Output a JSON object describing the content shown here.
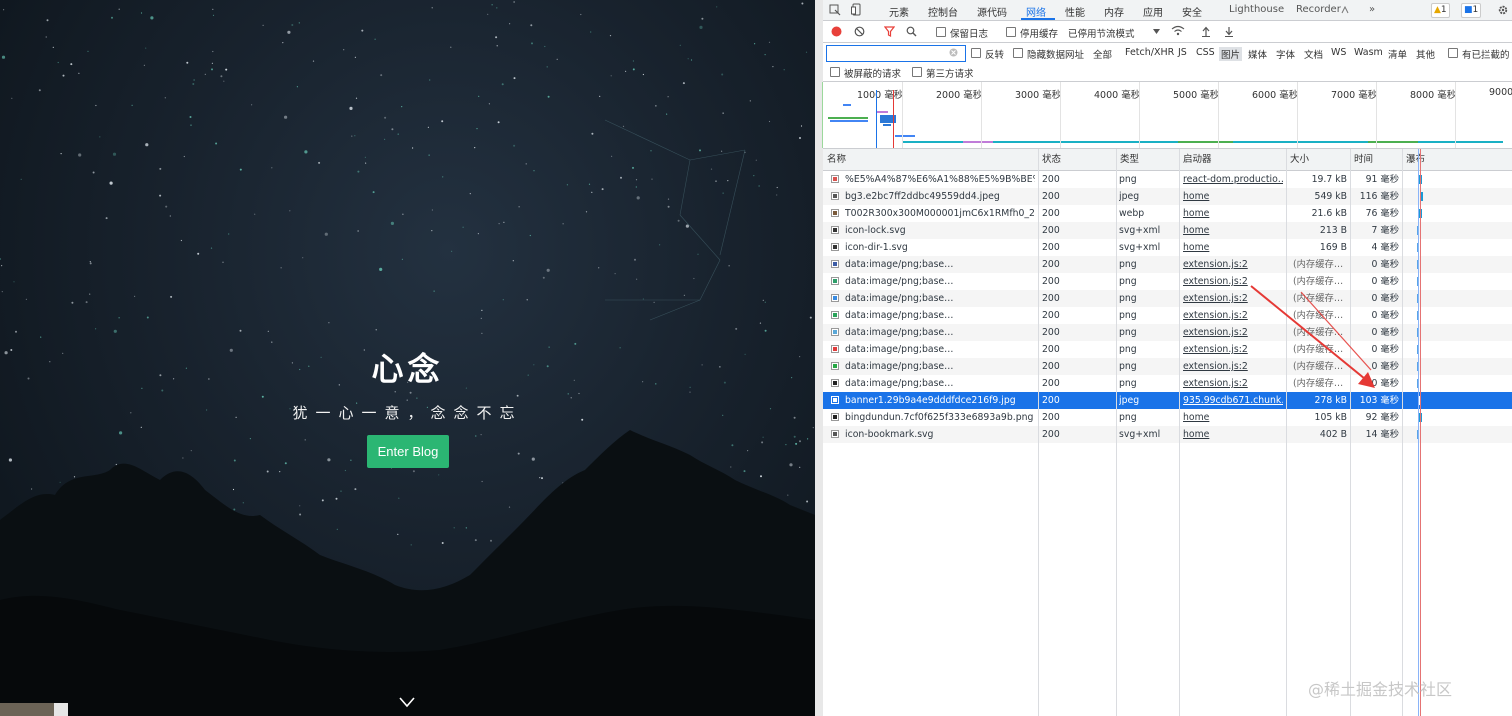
{
  "site": {
    "title": "心念",
    "subtitle": "犹一心一意，念念不忘",
    "enter_button": "Enter Blog"
  },
  "devtools": {
    "tabs": [
      "元素",
      "控制台",
      "源代码",
      "网络",
      "性能",
      "内存",
      "应用",
      "安全",
      "Lighthouse",
      "Recorder"
    ],
    "selected_tab": "网络",
    "more_tabs": "»",
    "warnings_badge": "1",
    "messages_badge": "1",
    "toolbar": {
      "preserve_log": "保留日志",
      "disable_cache": "停用缓存",
      "throttling": "已停用节流模式"
    },
    "filter": {
      "placeholder": "",
      "invert": "反转",
      "hide_data_urls": "隐藏数据网址",
      "types": [
        "全部",
        "Fetch/XHR",
        "JS",
        "CSS",
        "图片",
        "媒体",
        "字体",
        "文档",
        "WS",
        "Wasm",
        "清单",
        "其他"
      ],
      "selected_type": "图片",
      "blocked_cookies": "有已拦截的",
      "blocked_requests": "被屏蔽的请求",
      "third_party": "第三方请求"
    },
    "overview_ticks": [
      "1000 毫秒",
      "2000 毫秒",
      "3000 毫秒",
      "4000 毫秒",
      "5000 毫秒",
      "6000 毫秒",
      "7000 毫秒",
      "8000 毫秒",
      "9000"
    ],
    "columns": [
      "名称",
      "状态",
      "类型",
      "启动器",
      "大小",
      "时间",
      "瀑布"
    ],
    "rows": [
      {
        "name": "%E5%A4%87%E6%A1%88%E5%9B%BE%E…",
        "status": "200",
        "type": "png",
        "initiator": "react-dom.productio…",
        "size": "19.7 kB",
        "time": "91 毫秒",
        "icon": "image-icon",
        "color": "#d9534f"
      },
      {
        "name": "bg3.e2bc7ff2ddbc49559dd4.jpeg",
        "status": "200",
        "type": "jpeg",
        "initiator": "home",
        "size": "549 kB",
        "time": "116 毫秒",
        "icon": "image-icon",
        "color": "#555555"
      },
      {
        "name": "T002R300x300M000001jmC6x1RMfh0_2.j…",
        "status": "200",
        "type": "webp",
        "initiator": "home",
        "size": "21.6 kB",
        "time": "76 毫秒",
        "icon": "image-icon",
        "color": "#7a5a3a"
      },
      {
        "name": "icon-lock.svg",
        "status": "200",
        "type": "svg+xml",
        "initiator": "home",
        "size": "213 B",
        "time": "7 毫秒",
        "icon": "image-icon",
        "color": "#333333"
      },
      {
        "name": "icon-dir-1.svg",
        "status": "200",
        "type": "svg+xml",
        "initiator": "home",
        "size": "169 B",
        "time": "4 毫秒",
        "icon": "image-icon",
        "color": "#333333"
      },
      {
        "name": "data:image/png;base…",
        "status": "200",
        "type": "png",
        "initiator": "extension.js:2",
        "size": "(内存缓存…",
        "time": "0 毫秒",
        "icon": "image-icon",
        "color": "#3b5ba5"
      },
      {
        "name": "data:image/png;base…",
        "status": "200",
        "type": "png",
        "initiator": "extension.js:2",
        "size": "(内存缓存…",
        "time": "0 毫秒",
        "icon": "image-icon",
        "color": "#2e9e6a"
      },
      {
        "name": "data:image/png;base…",
        "status": "200",
        "type": "png",
        "initiator": "extension.js:2",
        "size": "(内存缓存…",
        "time": "0 毫秒",
        "icon": "image-icon",
        "color": "#3a8be0"
      },
      {
        "name": "data:image/png;base…",
        "status": "200",
        "type": "png",
        "initiator": "extension.js:2",
        "size": "(内存缓存…",
        "time": "0 毫秒",
        "icon": "image-icon",
        "color": "#29a35a"
      },
      {
        "name": "data:image/png;base…",
        "status": "200",
        "type": "png",
        "initiator": "extension.js:2",
        "size": "(内存缓存…",
        "time": "0 毫秒",
        "icon": "image-icon",
        "color": "#5aa8d8"
      },
      {
        "name": "data:image/png;base…",
        "status": "200",
        "type": "png",
        "initiator": "extension.js:2",
        "size": "(内存缓存…",
        "time": "0 毫秒",
        "icon": "image-icon",
        "color": "#e03c3c"
      },
      {
        "name": "data:image/png;base…",
        "status": "200",
        "type": "png",
        "initiator": "extension.js:2",
        "size": "(内存缓存…",
        "time": "0 毫秒",
        "icon": "image-icon",
        "color": "#27a844"
      },
      {
        "name": "data:image/png;base…",
        "status": "200",
        "type": "png",
        "initiator": "extension.js:2",
        "size": "(内存缓存…",
        "time": "0 毫秒",
        "icon": "image-icon",
        "color": "#222222"
      },
      {
        "name": "banner1.29b9a4e9dddfdce216f9.jpg",
        "status": "200",
        "type": "jpeg",
        "initiator": "935.99cdb671.chunk…",
        "size": "278 kB",
        "time": "103 毫秒",
        "icon": "image-icon",
        "color": "#ffffff",
        "selected": true
      },
      {
        "name": "bingdundun.7cf0f625f333e6893a9b.png",
        "status": "200",
        "type": "png",
        "initiator": "home",
        "size": "105 kB",
        "time": "92 毫秒",
        "icon": "image-icon",
        "color": "#222222"
      },
      {
        "name": "icon-bookmark.svg",
        "status": "200",
        "type": "svg+xml",
        "initiator": "home",
        "size": "402 B",
        "time": "14 毫秒",
        "icon": "image-icon",
        "color": "#555555"
      }
    ]
  },
  "watermark": "@稀土掘金技术社区",
  "colors": {
    "accent": "#1a73e8",
    "enter_button": "#2bb673",
    "annotation_arrow": "#e53935"
  }
}
